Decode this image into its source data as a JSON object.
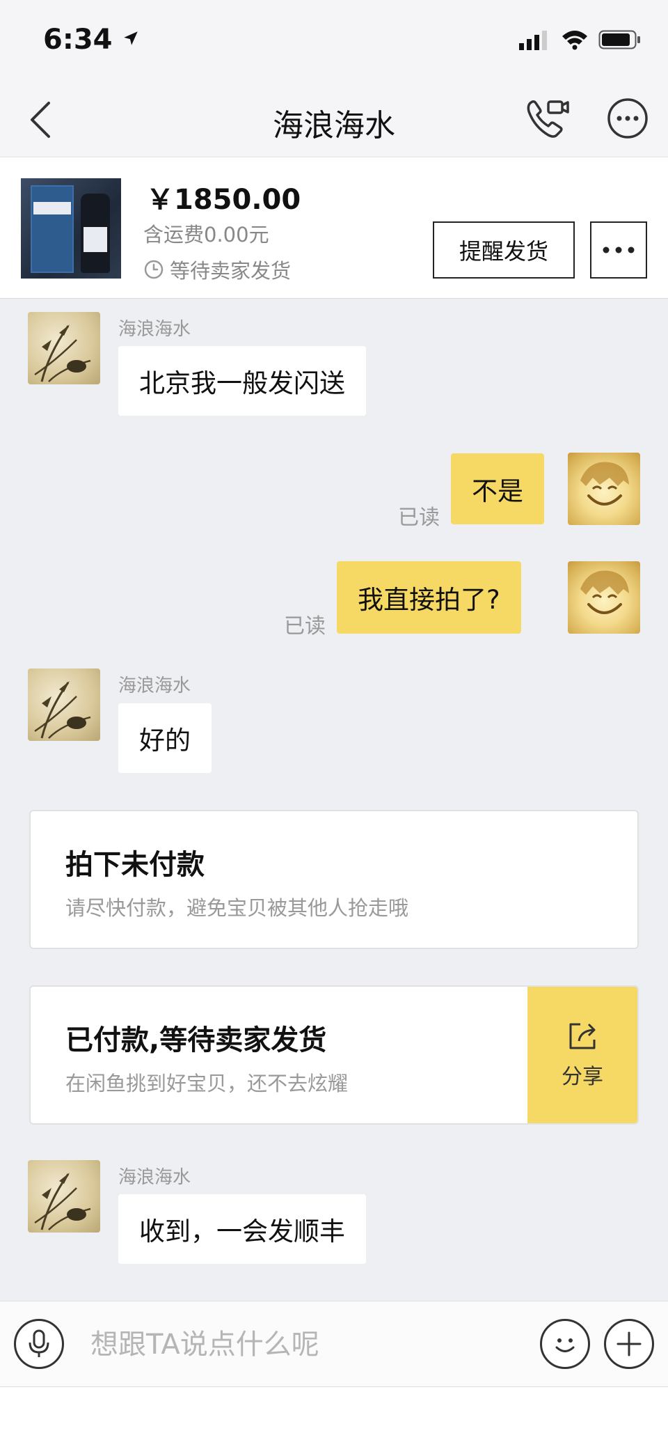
{
  "status_bar": {
    "time": "6:34"
  },
  "nav": {
    "title": "海浪海水"
  },
  "order": {
    "price": "￥1850.00",
    "shipping": "含运费0.00元",
    "status": "等待卖家发货",
    "remind_button": "提醒发货"
  },
  "messages": [
    {
      "sender": "海浪海水",
      "text": "北京我一般发闪送"
    },
    {
      "text": "不是",
      "read": "已读"
    },
    {
      "text": "我直接拍了?",
      "read": "已读"
    },
    {
      "sender": "海浪海水",
      "text": "好的"
    },
    {
      "sender": "海浪海水",
      "text": "收到，一会发顺丰"
    }
  ],
  "system_cards": [
    {
      "title": "拍下未付款",
      "desc": "请尽快付款，避免宝贝被其他人抢走哦"
    },
    {
      "title": "已付款,等待卖家发货",
      "desc": "在闲鱼挑到好宝贝，还不去炫耀",
      "action": "分享"
    }
  ],
  "input": {
    "placeholder": "想跟TA说点什么呢"
  },
  "colors": {
    "accent_yellow": "#f6d964",
    "background": "#eeeff3"
  },
  "icons": [
    "location-arrow-icon",
    "signal-icon",
    "wifi-icon",
    "battery-icon",
    "back-icon",
    "phone-video-icon",
    "more-icon",
    "clock-icon",
    "share-icon",
    "microphone-icon",
    "emoji-icon",
    "plus-icon"
  ]
}
